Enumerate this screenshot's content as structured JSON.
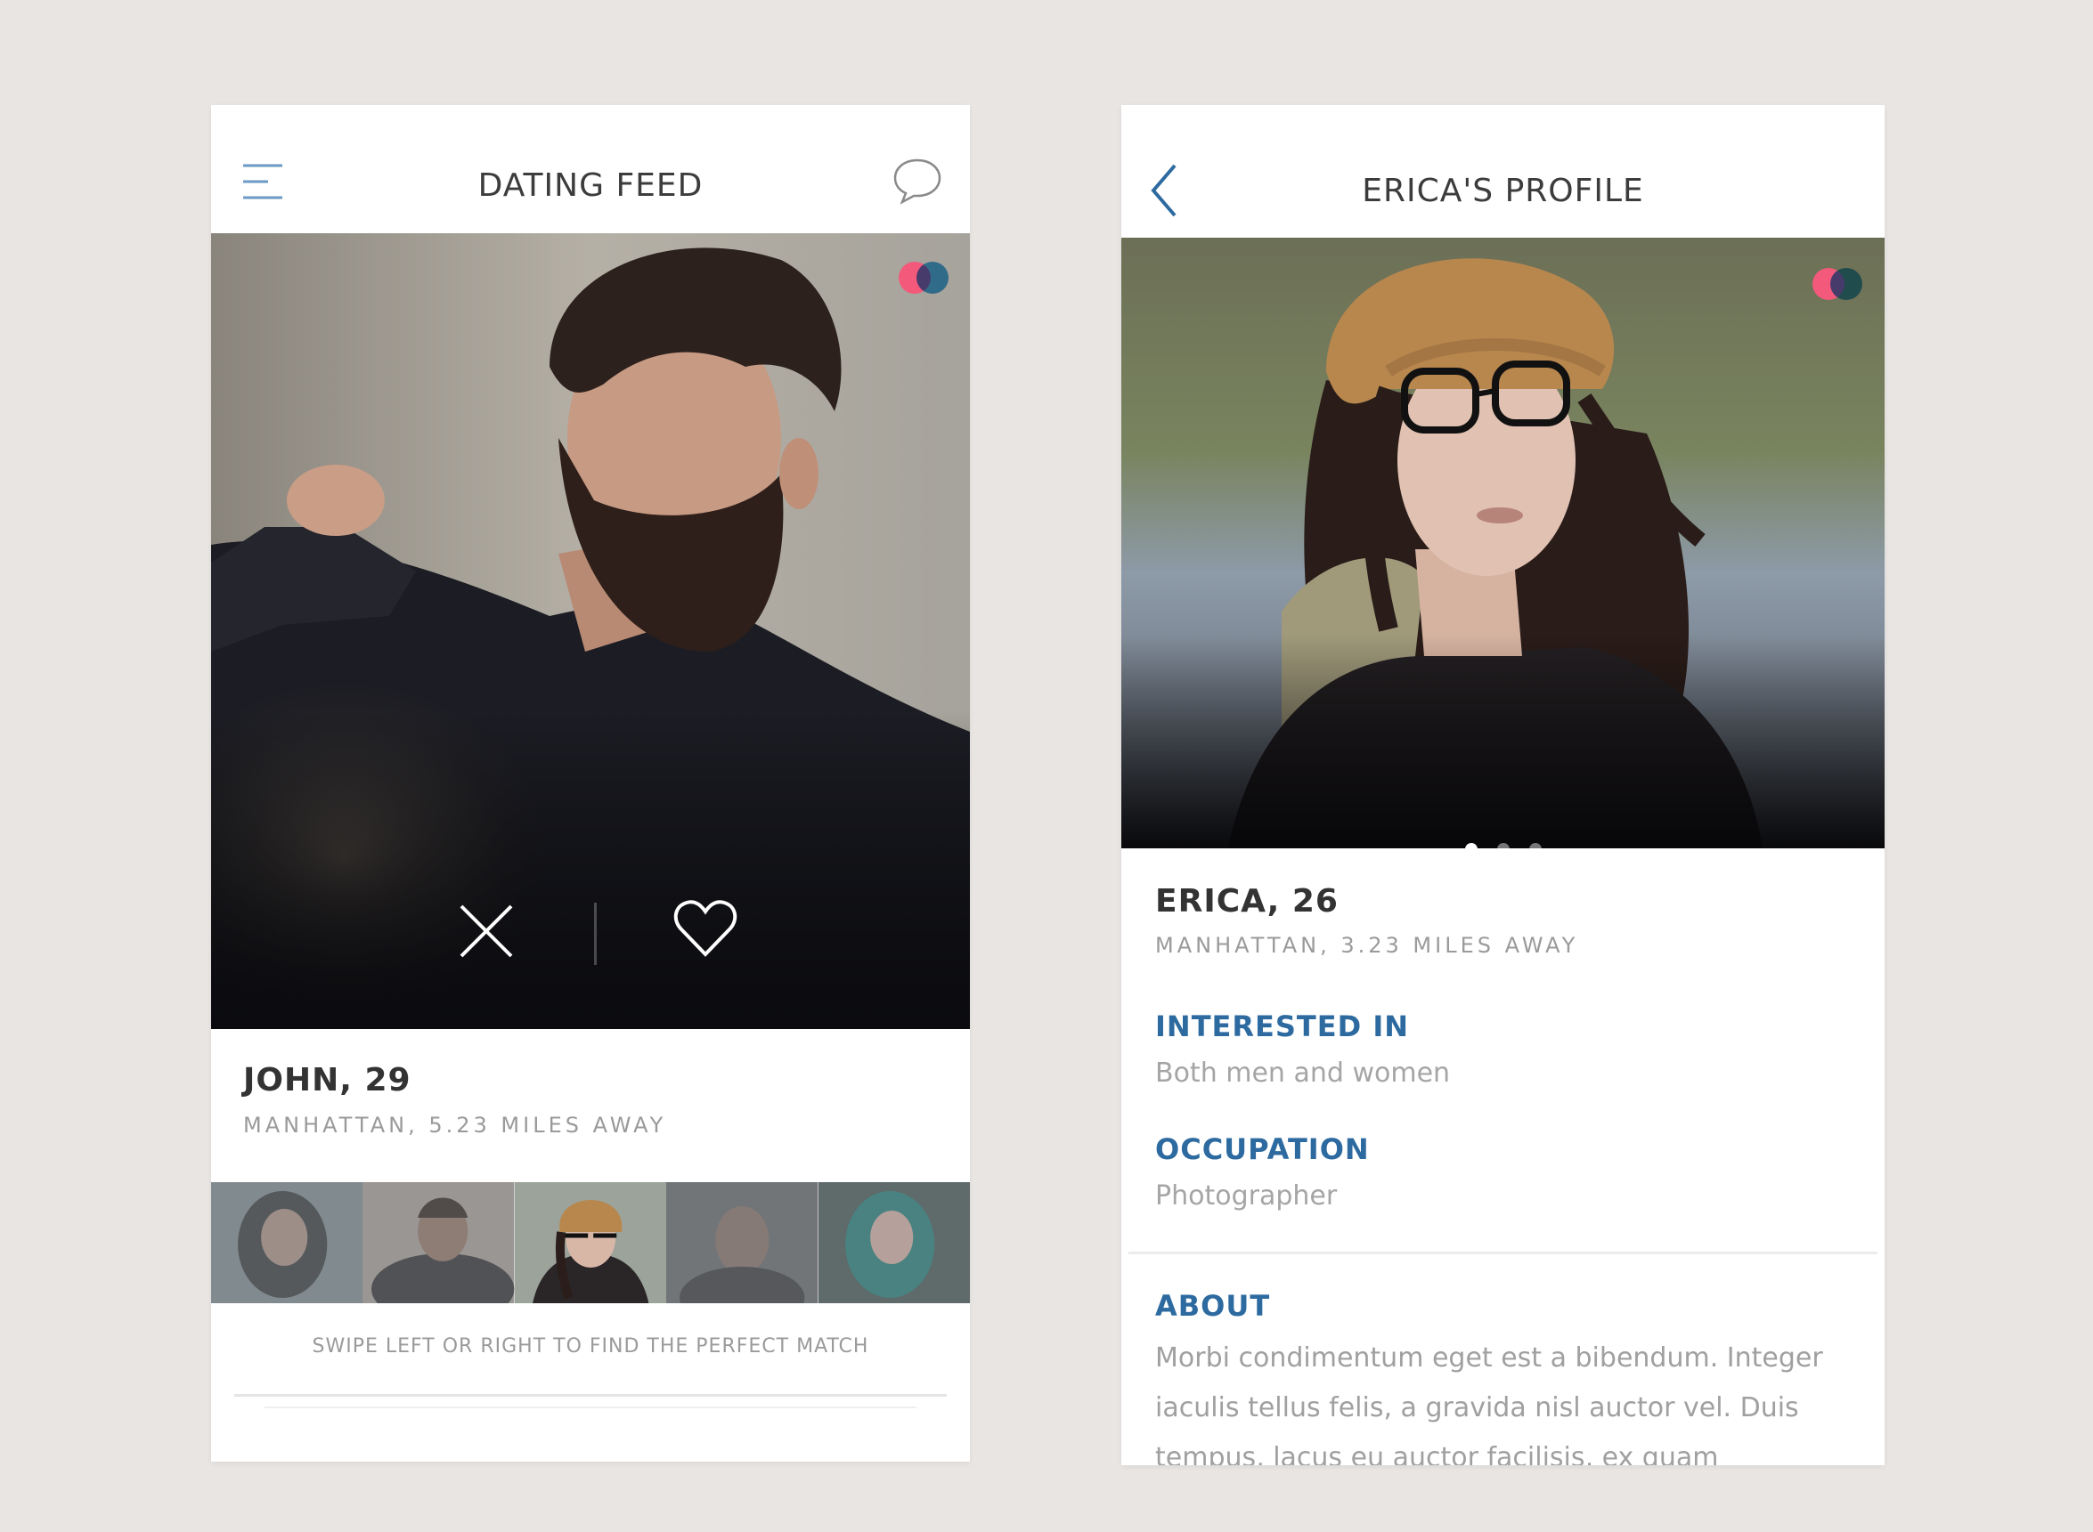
{
  "colors": {
    "background": "#e8e5e3",
    "accent_blue": "#2d6aa0",
    "match_pink": "#f2597a",
    "match_blue": "#4aa7e0"
  },
  "feed": {
    "title": "DATING FEED",
    "menu_icon": "hamburger-menu-icon",
    "chat_icon": "chat-bubble-icon",
    "profile": {
      "name": "JOHN, 29",
      "location": "MANHATTAN, 5.23 MILES AWAY"
    },
    "actions": {
      "dislike_icon": "close-x-icon",
      "like_icon": "heart-icon"
    },
    "thumbnails": [
      {
        "selected": false
      },
      {
        "selected": false
      },
      {
        "selected": true
      },
      {
        "selected": false
      },
      {
        "selected": false
      }
    ],
    "hint": "SWIPE LEFT OR RIGHT TO FIND THE PERFECT MATCH"
  },
  "profile_page": {
    "title": "ERICA'S PROFILE",
    "back_icon": "chevron-left-icon",
    "name": "ERICA, 26",
    "location": "MANHATTAN, 3.23 MILES AWAY",
    "photo_pager": {
      "count": 3,
      "active_index": 0
    },
    "interested_in": {
      "label": "INTERESTED IN",
      "value": "Both men and women"
    },
    "occupation": {
      "label": "OCCUPATION",
      "value": "Photographer"
    },
    "about": {
      "label": "ABOUT",
      "text": "Morbi condimentum eget est a bibendum. Integer iaculis tellus felis, a gravida nisl auctor vel. Duis tempus, lacus eu auctor facilisis, ex quam"
    }
  }
}
